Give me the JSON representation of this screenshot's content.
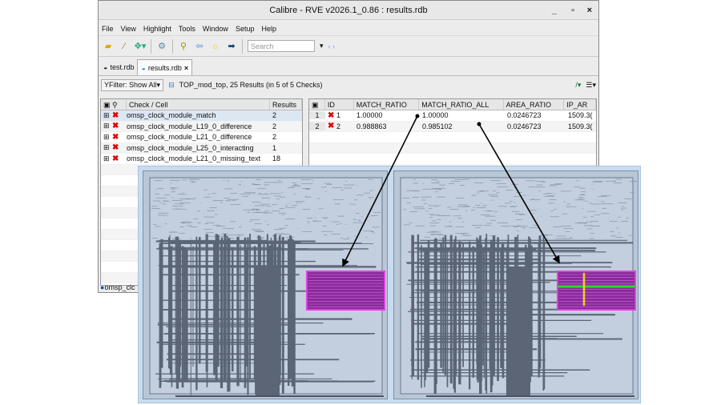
{
  "window": {
    "title": "Calibre - RVE v2026.1_0.86 : results.rdb",
    "minimize": "_",
    "maximize": "▫",
    "close": "×"
  },
  "menu": [
    "File",
    "View",
    "Highlight",
    "Tools",
    "Window",
    "Setup",
    "Help"
  ],
  "toolbar": {
    "search_placeholder": "Search"
  },
  "tabs": [
    {
      "label": "test.rdb"
    },
    {
      "label": "results.rdb",
      "close": "×"
    }
  ],
  "filter": {
    "label": "Filter: Show All",
    "summary": "TOP_mod_top, 25 Results (in 5 of 5 Checks)"
  },
  "checks": {
    "headers": [
      "Check / Cell",
      "Results"
    ],
    "rows": [
      {
        "name": "omsp_clock_module_match",
        "results": "2"
      },
      {
        "name": "omsp_clock_module_L19_0_difference",
        "results": "2"
      },
      {
        "name": "omsp_clock_module_L21_0_difference",
        "results": "2"
      },
      {
        "name": "omsp_clock_module_L25_0_interacting",
        "results": "1"
      },
      {
        "name": "omsp_clock_module_L21_0_missing_text",
        "results": "18"
      }
    ]
  },
  "results": {
    "headers": [
      "ID",
      "MATCH_RATIO",
      "MATCH_RATIO_ALL",
      "AREA_RATIO",
      "IP_AR"
    ],
    "rows": [
      {
        "num": "1",
        "id": "1",
        "match_ratio": "1.00000",
        "match_ratio_all": "1.00000",
        "area_ratio": "0.0246723",
        "ip_ar": "1509.3("
      },
      {
        "num": "2",
        "id": "2",
        "match_ratio": "0.988863",
        "match_ratio_all": "0.985102",
        "area_ratio": "0.0246723",
        "ip_ar": "1509.3("
      }
    ]
  },
  "status": {
    "text": "omsp_clc"
  },
  "colors": {
    "highlight": "#e040e0",
    "green_marker": "#22dd22",
    "yellow_marker": "#f0d020",
    "error": "#dd0000"
  }
}
